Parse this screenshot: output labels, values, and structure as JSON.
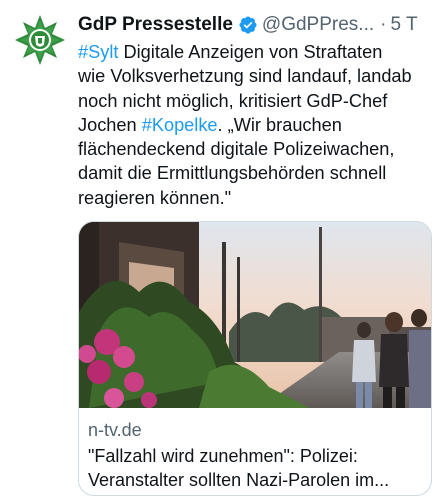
{
  "author": {
    "name": "GdP Pressestelle",
    "handle": "@GdPPres...",
    "separator": "·",
    "time": "5 T",
    "avatar_icon": "police-star-emblem-icon",
    "verified_icon": "verified-badge-icon"
  },
  "tweet": {
    "lines": [
      {
        "tag": "#Sylt",
        "text": " Digitale Anzeigen von Straftaten"
      },
      {
        "text": "wie Volksverhetzung sind landauf, landab"
      },
      {
        "text": "noch nicht möglich, kritisiert GdP-Chef"
      },
      {
        "text_before": "Jochen ",
        "tag": "#Kopelke",
        "text_after": ". „Wir brauchen"
      },
      {
        "text": "flächendeckend digitale Polizeiwachen,"
      },
      {
        "text": "damit die Ermittlungsbehörden schnell"
      },
      {
        "text": "reagieren können.\""
      }
    ]
  },
  "card": {
    "domain": "n-tv.de",
    "title_lines": [
      "\"Fallzahl wird zunehmen\": Polizei:",
      "Veranstalter sollten Nazi-Parolen im..."
    ]
  },
  "colors": {
    "link": "#1d9bf0",
    "secondary_text": "#536471",
    "verified": "#1d9bf0",
    "emblem_green": "#2e8b3a"
  }
}
